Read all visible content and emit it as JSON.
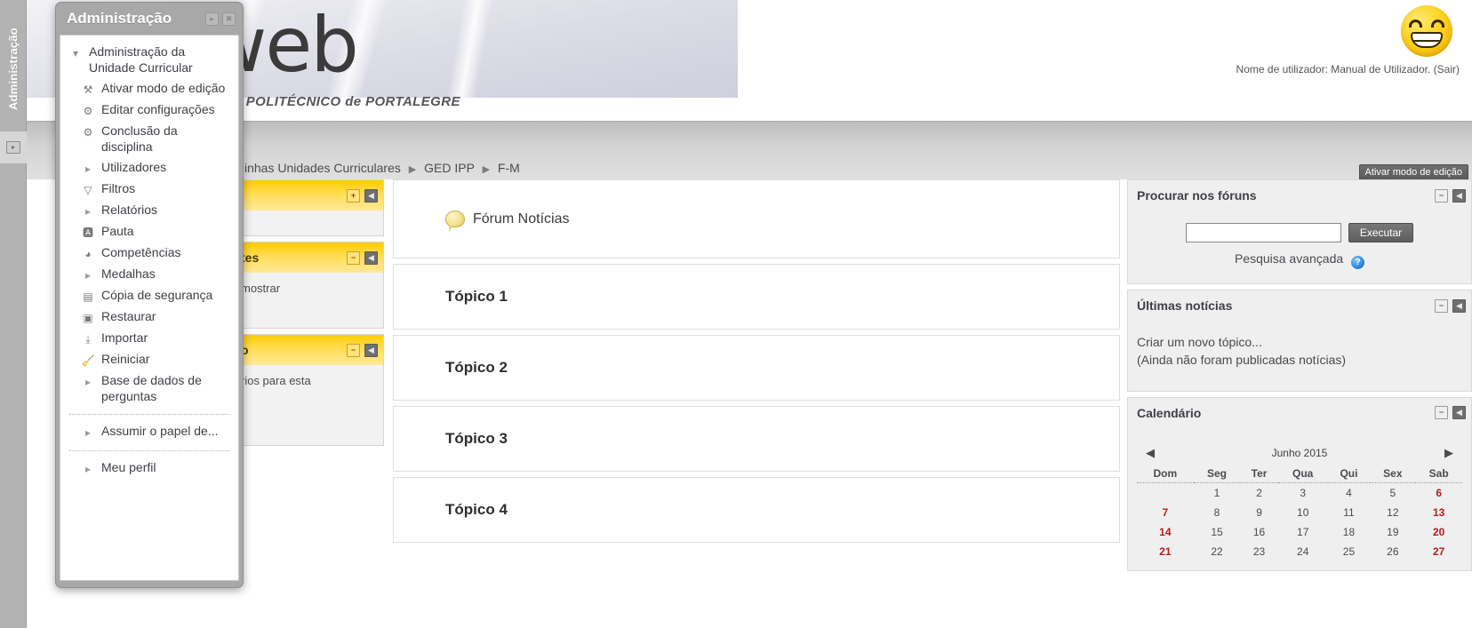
{
  "dock": {
    "label": "Administração",
    "expand_icon": "chevron-right-icon"
  },
  "banner": {
    "logo_text": "web",
    "subtitle": "TUTO POLITÉCNICO de PORTALEGRE"
  },
  "user": {
    "line": "Nome de utilizador: Manual de Utilizador. (Sair)",
    "avatar_icon": "smiley-avatar"
  },
  "navbar": {
    "breadcrumb": [
      "inhas Unidades Curriculares",
      "GED IPP",
      "F-M"
    ],
    "separator": "▶",
    "edit_button": "Ativar modo de edição"
  },
  "admin_panel": {
    "title": "Administração",
    "dock_icon": "dock-right-icon",
    "close_icon": "close-icon",
    "items": [
      {
        "label": "Administração da Unidade Curricular",
        "icon": "caret-down-icon",
        "type": "caret-down"
      },
      {
        "label": "Ativar modo de edição",
        "icon": "tools-icon",
        "type": "icon",
        "glyph": "⚒"
      },
      {
        "label": "Editar configurações",
        "icon": "gear-icon",
        "type": "icon",
        "glyph": "⚙"
      },
      {
        "label": "Conclusão da disciplina",
        "icon": "gear-icon",
        "type": "icon",
        "glyph": "⚙"
      },
      {
        "label": "Utilizadores",
        "icon": "caret-right-icon",
        "type": "caret-right"
      },
      {
        "label": "Filtros",
        "icon": "funnel-icon",
        "type": "icon",
        "glyph": "▽"
      },
      {
        "label": "Relatórios",
        "icon": "caret-right-icon",
        "type": "caret-right"
      },
      {
        "label": "Pauta",
        "icon": "document-icon",
        "type": "icon",
        "glyph": "🅰"
      },
      {
        "label": "Competências",
        "icon": "competency-icon",
        "type": "icon",
        "glyph": "◕"
      },
      {
        "label": "Medalhas",
        "icon": "caret-right-icon",
        "type": "caret-right"
      },
      {
        "label": "Cópia de segurança",
        "icon": "backup-icon",
        "type": "icon",
        "glyph": "▤"
      },
      {
        "label": "Restaurar",
        "icon": "restore-icon",
        "type": "icon",
        "glyph": "▣"
      },
      {
        "label": "Importar",
        "icon": "import-icon",
        "type": "icon",
        "glyph": "⤓"
      },
      {
        "label": "Reiniciar",
        "icon": "broom-icon",
        "type": "icon",
        "glyph": "🧹"
      },
      {
        "label": "Base de dados de perguntas",
        "icon": "caret-right-icon",
        "type": "caret-right"
      }
    ],
    "items_after_sep1": [
      {
        "label": "Assumir o papel de...",
        "icon": "caret-right-icon",
        "type": "caret-right"
      }
    ],
    "items_after_sep2": [
      {
        "label": "Meu perfil",
        "icon": "caret-right-icon",
        "type": "caret-right"
      }
    ]
  },
  "left_blocks": [
    {
      "title": "",
      "icons": [
        "plus-icon",
        "dock-icon"
      ],
      "collapse_glyph": "+",
      "body": ""
    },
    {
      "title": "tes",
      "icons": [
        "minus-icon",
        "dock-icon"
      ],
      "collapse_glyph": "−",
      "body": "mostrar"
    },
    {
      "title": "o",
      "icons": [
        "minus-icon",
        "dock-icon"
      ],
      "collapse_glyph": "−",
      "body": "rios para esta"
    }
  ],
  "main": {
    "forum": {
      "label": "Fórum Notícias",
      "icon": "forum-bubble-icon"
    },
    "topics": [
      "Tópico 1",
      "Tópico 2",
      "Tópico 3",
      "Tópico 4"
    ]
  },
  "right_blocks": {
    "search_forums": {
      "title": "Procurar nos fóruns",
      "input_value": "",
      "input_placeholder": "",
      "button": "Executar",
      "advanced_link": "Pesquisa avançada",
      "help_icon": "help-icon",
      "collapse_glyph": "−",
      "dock_glyph": "◀"
    },
    "latest_news": {
      "title": "Últimas notícias",
      "lines": [
        "Criar um novo tópico...",
        "(Ainda não foram publicadas notícias)"
      ],
      "collapse_glyph": "−",
      "dock_glyph": "◀"
    },
    "calendar": {
      "title": "Calendário",
      "month": "Junho 2015",
      "prev_icon": "triangle-left-icon",
      "next_icon": "triangle-right-icon",
      "weekday_headers": [
        "Dom",
        "Seg",
        "Ter",
        "Qua",
        "Qui",
        "Sex",
        "Sab"
      ],
      "weeks": [
        [
          "",
          "1",
          "2",
          "3",
          "4",
          "5",
          "6"
        ],
        [
          "7",
          "8",
          "9",
          "10",
          "11",
          "12",
          "13"
        ],
        [
          "14",
          "15",
          "16",
          "17",
          "18",
          "19",
          "20"
        ],
        [
          "21",
          "22",
          "23",
          "24",
          "25",
          "26",
          "27"
        ]
      ],
      "weekend_columns": [
        0,
        6
      ],
      "collapse_glyph": "−",
      "dock_glyph": "◀"
    }
  },
  "colors": {
    "rail": "#b3b3b3",
    "yellow_header": "#ffcc00",
    "weekend_red": "#b02020",
    "accent_blue": "#1f7fd0"
  }
}
